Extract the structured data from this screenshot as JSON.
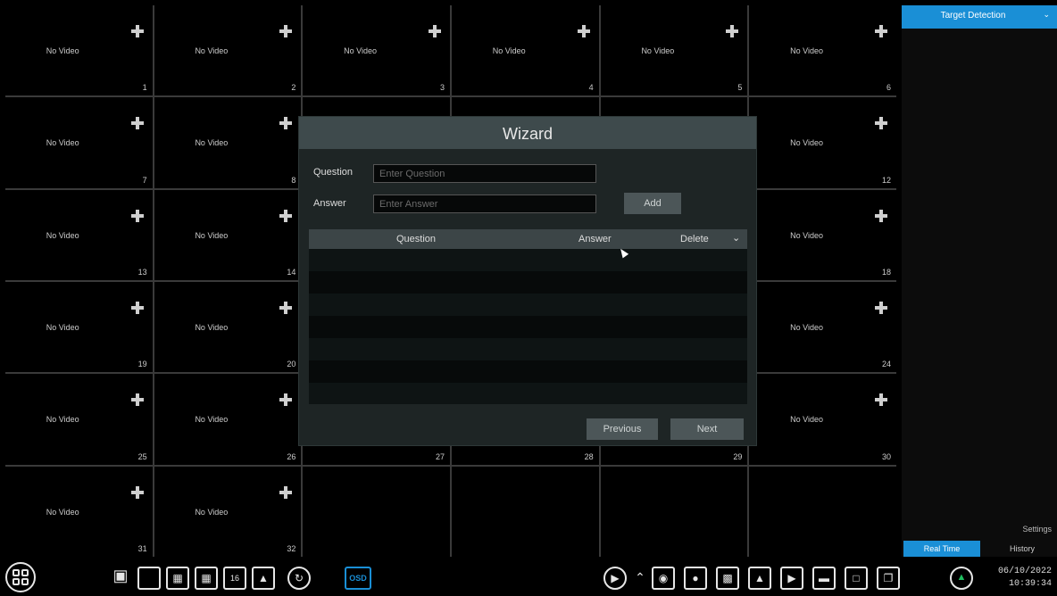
{
  "grid": {
    "cells": [
      {
        "label": "No Video",
        "num": "1",
        "add": true
      },
      {
        "label": "No Video",
        "num": "2",
        "add": true
      },
      {
        "label": "No Video",
        "num": "3",
        "add": true
      },
      {
        "label": "No Video",
        "num": "4",
        "add": true
      },
      {
        "label": "No Video",
        "num": "5",
        "add": true
      },
      {
        "label": "No Video",
        "num": "6",
        "add": true
      },
      {
        "label": "No Video",
        "num": "7",
        "add": true
      },
      {
        "label": "No Video",
        "num": "8",
        "add": true
      },
      {
        "label": "",
        "num": "",
        "add": false
      },
      {
        "label": "",
        "num": "",
        "add": false
      },
      {
        "label": "",
        "num": "",
        "add": false
      },
      {
        "label": "No Video",
        "num": "12",
        "add": true
      },
      {
        "label": "No Video",
        "num": "13",
        "add": true
      },
      {
        "label": "No Video",
        "num": "14",
        "add": true
      },
      {
        "label": "",
        "num": "",
        "add": false
      },
      {
        "label": "",
        "num": "",
        "add": false
      },
      {
        "label": "",
        "num": "",
        "add": false
      },
      {
        "label": "No Video",
        "num": "18",
        "add": true
      },
      {
        "label": "No Video",
        "num": "19",
        "add": true
      },
      {
        "label": "No Video",
        "num": "20",
        "add": true
      },
      {
        "label": "",
        "num": "",
        "add": false
      },
      {
        "label": "",
        "num": "",
        "add": false
      },
      {
        "label": "",
        "num": "",
        "add": false
      },
      {
        "label": "No Video",
        "num": "24",
        "add": true
      },
      {
        "label": "No Video",
        "num": "25",
        "add": true
      },
      {
        "label": "No Video",
        "num": "26",
        "add": true
      },
      {
        "label": "",
        "num": "27",
        "add": false
      },
      {
        "label": "",
        "num": "28",
        "add": false
      },
      {
        "label": "",
        "num": "29",
        "add": false
      },
      {
        "label": "No Video",
        "num": "30",
        "add": true
      },
      {
        "label": "No Video",
        "num": "31",
        "add": true
      },
      {
        "label": "No Video",
        "num": "32",
        "add": true
      },
      {
        "label": "",
        "num": "",
        "add": false
      },
      {
        "label": "",
        "num": "",
        "add": false
      },
      {
        "label": "",
        "num": "",
        "add": false
      },
      {
        "label": "",
        "num": "",
        "add": false
      }
    ]
  },
  "right_panel": {
    "header": "Target Detection",
    "settings": "Settings",
    "tab_realtime": "Real Time",
    "tab_history": "History"
  },
  "dialog": {
    "title": "Wizard",
    "question_label": "Question",
    "question_placeholder": "Enter Question",
    "answer_label": "Answer",
    "answer_placeholder": "Enter Answer",
    "add_button": "Add",
    "table_headers": {
      "question": "Question",
      "answer": "Answer",
      "delete": "Delete"
    },
    "previous_button": "Previous",
    "next_button": "Next"
  },
  "toolbar": {
    "osd": "OSD",
    "layout16": "16",
    "date": "06/10/2022",
    "time": "10:39:34"
  },
  "colors": {
    "accent": "#1a8fd6"
  }
}
